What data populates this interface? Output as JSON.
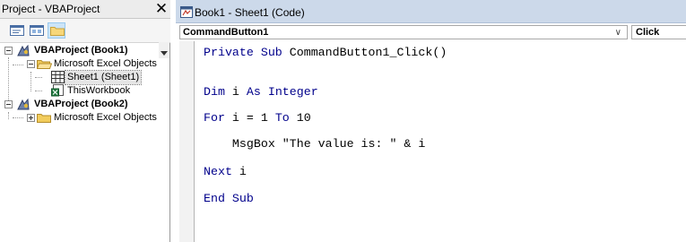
{
  "project_pane": {
    "title": "Project - VBAProject",
    "close_glyph": "✕",
    "toolbar": [
      {
        "name": "view-code-button",
        "icon": "view-code-icon",
        "active": false
      },
      {
        "name": "view-object-button",
        "icon": "view-object-icon",
        "active": false
      },
      {
        "name": "toggle-folders-button",
        "icon": "folder-icon",
        "active": true
      }
    ],
    "tree": [
      {
        "label": "VBAProject (Book1)",
        "icon": "vba-project-icon",
        "expander": "−",
        "bold": true
      },
      {
        "label": "Microsoft Excel Objects",
        "icon": "open-folder-icon",
        "expander": "−",
        "bold": false
      },
      {
        "label": "Sheet1 (Sheet1)",
        "icon": "worksheet-icon",
        "selected": true
      },
      {
        "label": "ThisWorkbook",
        "icon": "workbook-icon"
      },
      {
        "label": "VBAProject (Book2)",
        "icon": "vba-project-icon",
        "expander": "−",
        "bold": true
      },
      {
        "label": "Microsoft Excel Objects",
        "icon": "folder-icon",
        "expander": "+",
        "bold": false
      }
    ]
  },
  "code_window": {
    "title": "Book1 - Sheet1 (Code)",
    "object_combo": "CommandButton1",
    "procedure_combo": "Click",
    "combo_arrow": "∨",
    "lines": [
      {
        "kw": "Private Sub",
        "rest": " CommandButton1_Click()"
      },
      {
        "kw": "Dim",
        "mid": " i ",
        "kw2": "As Integer"
      },
      {
        "kw": "For",
        "mid": " i = 1 ",
        "kw2": "To",
        "rest": " 10"
      },
      {
        "indent": "    ",
        "rest": "MsgBox \"The value is: \" & i"
      },
      {
        "kw": "Next",
        "rest": " i"
      },
      {
        "kw": "End Sub"
      }
    ]
  },
  "colors": {
    "keyword": "#00008b",
    "title_bar": "#ccd9ea",
    "selection": "#e5e5e5"
  }
}
